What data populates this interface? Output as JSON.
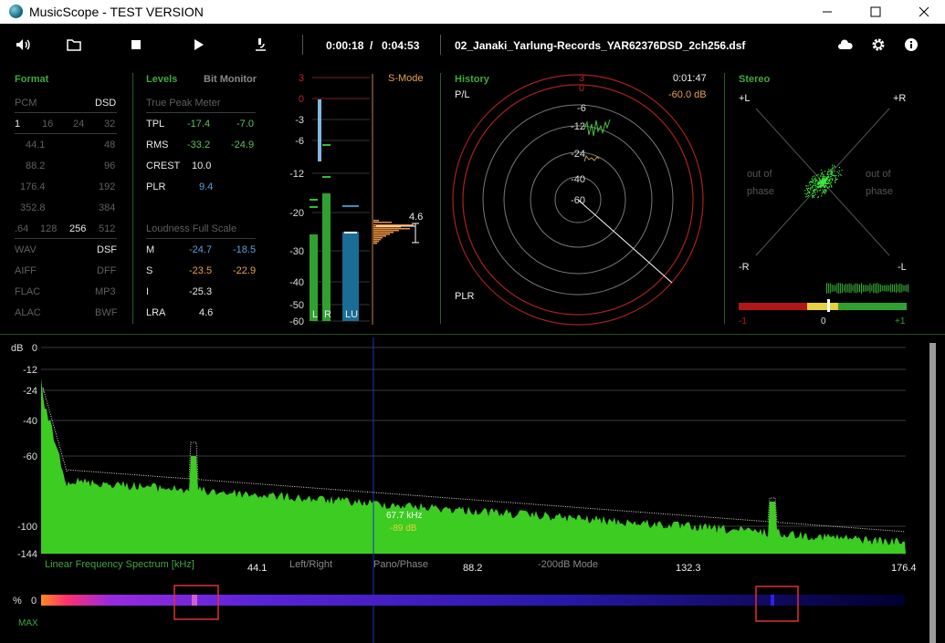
{
  "window": {
    "title": "MusicScope - TEST VERSION"
  },
  "toolbar": {
    "time_current": "0:00:18",
    "time_separator": "/",
    "time_total": "0:04:53",
    "filename": "02_Janaki_Yarlung-Records_YAR62376DSD_2ch256.dsf"
  },
  "format": {
    "title": "Format",
    "pcm": "PCM",
    "dsd": "DSD",
    "bits": [
      "1",
      "16",
      "24",
      "32"
    ],
    "rates_pcm": [
      "44.1",
      "88.2",
      "176.4",
      "352.8"
    ],
    "rates_dsd": [
      "48",
      "96",
      "192",
      "384"
    ],
    "dsd_rates": [
      ".64",
      "128",
      "256",
      "512"
    ],
    "files_left": [
      "WAV",
      "AIFF",
      "FLAC",
      "ALAC"
    ],
    "files_right": [
      "DSF",
      "DFF",
      "MP3",
      "BWF"
    ]
  },
  "levels": {
    "title": "Levels",
    "bit_monitor": "Bit Monitor",
    "true_peak": "True Peak Meter",
    "tpl": {
      "label": "TPL",
      "l": "-17.4",
      "r": "-7.0"
    },
    "rms": {
      "label": "RMS",
      "l": "-33.2",
      "r": "-24.9"
    },
    "crest": {
      "label": "CREST",
      "v": "10.0"
    },
    "plr": {
      "label": "PLR",
      "v": "9.4"
    },
    "loudness": "Loudness Full Scale",
    "m": {
      "label": "M",
      "a": "-24.7",
      "b": "-18.5"
    },
    "s": {
      "label": "S",
      "a": "-23.5",
      "b": "-22.9"
    },
    "i": {
      "label": "I",
      "v": "-25.3"
    },
    "lra": {
      "label": "LRA",
      "v": "4.6"
    }
  },
  "meter": {
    "scale": [
      "3",
      "0",
      "-3",
      "-6",
      "-12",
      "-20",
      "-30",
      "-40",
      "-50",
      "-60"
    ],
    "bars": {
      "l": "L",
      "r": "R",
      "lu": "LU"
    },
    "smode": "S-Mode",
    "lra_value": "4.6"
  },
  "history": {
    "title": "History",
    "time": "0:01:47",
    "pl": "P/L",
    "db": "-60.0 dB",
    "plr": "PLR",
    "rings": [
      "3",
      "0",
      "-6",
      "-12",
      "-24",
      "-40",
      "-60"
    ]
  },
  "stereo": {
    "title": "Stereo",
    "plus_l": "+L",
    "plus_r": "+R",
    "minus_r": "-R",
    "minus_l": "-L",
    "out_of": "out of",
    "phase": "phase",
    "corr_min": "-1",
    "corr_mid": "0",
    "corr_max": "+1"
  },
  "spectrum": {
    "db_label": "dB",
    "db_ticks": [
      "0",
      "-12",
      "-24",
      "-40",
      "-60",
      "-100",
      "-144"
    ],
    "freq_ticks": [
      "44.1",
      "88.2",
      "132.3",
      "176.4"
    ],
    "title": "Linear Frequency Spectrum [kHz]",
    "left_right": "Left/Right",
    "pano_phase": "Pano/Phase",
    "mode": "-200dB Mode",
    "cursor_freq": "67.7 kHz",
    "cursor_db": "-89 dB"
  },
  "bar": {
    "percent": "%",
    "zero": "0",
    "max": "MAX"
  },
  "colors": {
    "accent_green": "#3fa83f",
    "meter_blue": "#1a6e96",
    "ring_red": "#a82020"
  }
}
